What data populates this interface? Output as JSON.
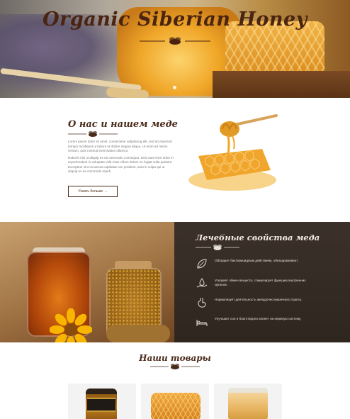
{
  "hero": {
    "title": "Organic Siberian Honey"
  },
  "about": {
    "title": "О нас и нашем меде",
    "paragraph1": "Lorem ipsum dolor sit amet, consectetur adipisicing elit, sed do eiusmod tempor incididunt ut labore et dolore magna aliqua. Ut enim ad minim veniam, quis nostrud exercitation ullamco.",
    "paragraph2": "Raboris nisi ut aliquip ex ea commodo consequat. Duis aute irure dolor in reprehenderit in voluptate velit esse cillum dolore eu fugiat nulla pariatur. Excepteur sint occaecat cupidatat non proident, sunt in culpa qui ut aliquip ex ea commodo repeh.",
    "button_label": "Узнать больше →"
  },
  "properties": {
    "title": "Лечебные свойства меда",
    "items": [
      {
        "icon": "leaf-icon",
        "text": "Обладает бактерицидным действием, обеззараживает."
      },
      {
        "icon": "hand-drop-icon",
        "text": "Ускоряет обмен веществ, стимулирует функцию внутренних органов."
      },
      {
        "icon": "stomach-icon",
        "text": "Нормализует деятельность желудочно-кишечного тракта."
      },
      {
        "icon": "bed-icon",
        "text": "Улучшает сон и благотворно влияет на нервную систему."
      }
    ]
  },
  "products": {
    "title": "Наши товары"
  },
  "colors": {
    "brand_brown": "#4a2a1a",
    "honey": "#e69a1f",
    "dark_panel": "#2f2620"
  }
}
